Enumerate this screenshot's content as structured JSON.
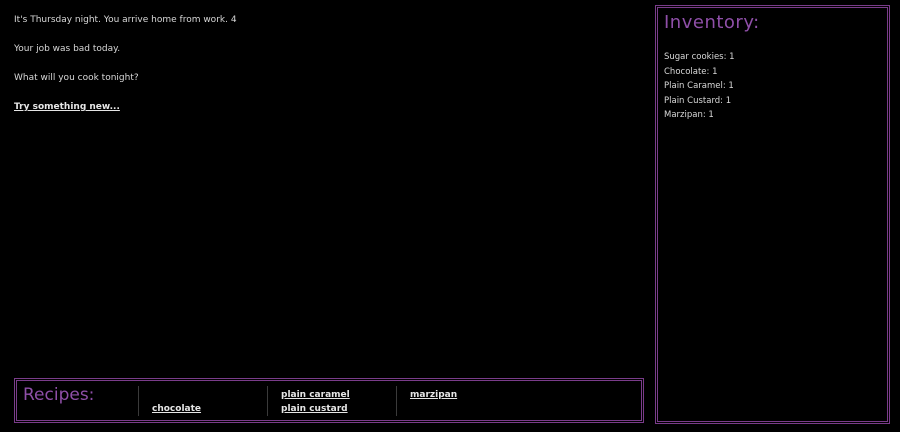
{
  "story": {
    "line1": "It's Thursday night. You arrive home from work. 4",
    "line2": "Your job was bad today.",
    "line3": "What will you cook tonight?",
    "action_link": "Try something new..."
  },
  "inventory": {
    "title": "Inventory:",
    "items": [
      "Sugar cookies: 1",
      "Chocolate: 1",
      "Plain Caramel: 1",
      "Plain Custard: 1",
      "Marzipan: 1"
    ]
  },
  "recipes": {
    "title": "Recipes:",
    "columns": [
      {
        "top": "",
        "bottom": "chocolate"
      },
      {
        "top": "plain caramel",
        "bottom": "plain custard"
      },
      {
        "top": "marzipan",
        "bottom": ""
      }
    ]
  },
  "colors": {
    "background": "#000000",
    "accent": "#8f4fa8",
    "border": "#7a3c8a",
    "text": "#d8d8d8"
  }
}
